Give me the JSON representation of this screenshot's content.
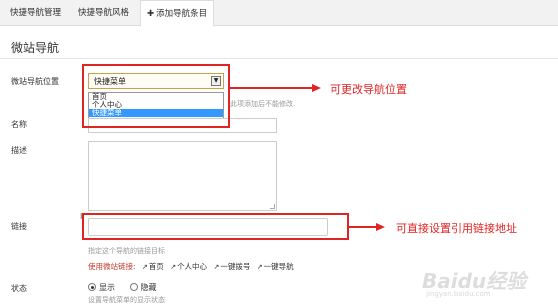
{
  "tabs": {
    "tab1": "快捷导航管理",
    "tab2": "快捷导航风格",
    "tab3_plus": "✚",
    "tab3": "添加导航条目"
  },
  "page_title": "微站导航",
  "form": {
    "position_label": "微站导航位置",
    "position_value": "快捷菜单",
    "position_options": [
      "首页",
      "个人中心",
      "快捷菜单"
    ],
    "position_help": "此项添加后不能修改.",
    "title_label": "名称",
    "desc_label": "描述",
    "link_label": "链接",
    "link_help": "指定这个导航的链接目标",
    "quicklinks_label": "使用微站链接:",
    "quicklinks": [
      "首页",
      "个人中心",
      "一键拨号",
      "一键导航"
    ],
    "status_label": "状态",
    "status_options": [
      "显示",
      "隐藏"
    ],
    "status_help": "设置导航菜单的显示状态"
  },
  "annotations": {
    "position_note": "可更改导航位置",
    "link_note": "可直接设置引用链接地址"
  },
  "watermark": {
    "brand": "Baidu经验",
    "url": "jingyan.baidu.com"
  },
  "colors": {
    "annotation_red": "#e02424",
    "selected_option": "#3399ff",
    "quicklinks_label": "#c0392b"
  }
}
